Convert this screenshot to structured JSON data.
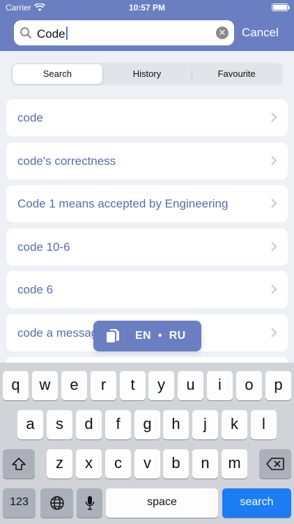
{
  "status_bar": {
    "carrier": "Carrier",
    "time": "10:57 PM"
  },
  "search": {
    "value": "Code",
    "cancel_label": "Cancel"
  },
  "tabs": [
    {
      "label": "Search",
      "active": true
    },
    {
      "label": "History",
      "active": false
    },
    {
      "label": "Favourite",
      "active": false
    }
  ],
  "results": [
    "code",
    "code's correctness",
    "Code 1 means accepted by Engineering",
    "code 10-6",
    "code 6",
    "code a message"
  ],
  "popup": {
    "from": "EN",
    "separator": "•",
    "to": "RU"
  },
  "keyboard": {
    "row1": [
      "q",
      "w",
      "e",
      "r",
      "t",
      "y",
      "u",
      "i",
      "o",
      "p"
    ],
    "row2": [
      "a",
      "s",
      "d",
      "f",
      "g",
      "h",
      "j",
      "k",
      "l"
    ],
    "row3": [
      "z",
      "x",
      "c",
      "v",
      "b",
      "n",
      "m"
    ],
    "numbers_label": "123",
    "space_label": "space",
    "search_label": "search"
  },
  "colors": {
    "header": "#6a7fc1",
    "result_text": "#5a6ca8",
    "search_key": "#1c7cf3"
  }
}
